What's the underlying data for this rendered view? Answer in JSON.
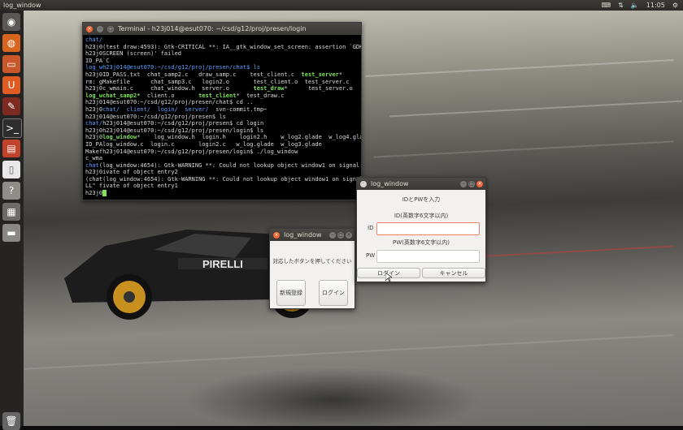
{
  "topbar": {
    "title": "log_window",
    "time": "11:05",
    "icons": [
      "keyboard-icon",
      "network-icon",
      "volume-icon",
      "gear-icon"
    ]
  },
  "launcher": {
    "items": [
      "ubuntu-dash-icon",
      "firefox-icon",
      "files-icon",
      "software-center-icon",
      "system-settings-icon",
      "terminal-icon",
      "app-icon",
      "document-icon",
      "help-icon",
      "workspace-switcher-icon",
      "drive-icon",
      "trash-icon"
    ]
  },
  "terminal": {
    "title": "Terminal - h23j014@esut070: ~/csd/g12/proj/presen/login",
    "lines": [
      [
        {
          "t": "chat/",
          "c": "b"
        }
      ],
      [
        {
          "t": "h23j0(test draw:4593): Gtk-CRITICAL **: IA__gtk_window_set_screen: assertion `GDK_IS"
        }
      ],
      [
        {
          "t": "h23j0SCREEN (screen)' failed"
        }
      ],
      [
        {
          "t": "ID_PA`C"
        }
      ],
      [
        {
          "t": "log_wh23j014@esut070:~/csd/g12/proj/presen/chat$ ls",
          "c": "b"
        }
      ],
      [
        {
          "t": "h23j0ID_PASS.txt  chat_samp2.c   draw_samp.c    test_client.c  "
        },
        {
          "t": "test_server",
          "c": "g"
        },
        {
          "t": "*"
        }
      ],
      [
        {
          "t": "rm: gMakefile      chat_samp3.c   login2.o       test_client.o  test_server.c"
        }
      ],
      [
        {
          "t": "h23j0c_wmain.c     chat_window.h  server.o       "
        },
        {
          "t": "test_draw",
          "c": "g"
        },
        {
          "t": "*      test_server.o"
        }
      ],
      [
        {
          "t": "log_wchat_samp2*",
          "c": "g"
        },
        {
          "t": "  client.o       "
        },
        {
          "t": "test_client",
          "c": "g"
        },
        {
          "t": "*  test_draw.c"
        }
      ],
      [
        {
          "t": "h23j014@esut070:~/csd/g12/proj/presen/chat$ cd .."
        }
      ],
      [
        {
          "t": "h23j0"
        },
        {
          "t": "chat/  client/  login/  server/",
          "c": "b"
        },
        {
          "t": "  svn-commit.tmp~"
        }
      ],
      [
        {
          "t": "h23j014@esut070:~/csd/g12/proj/presen$ ls"
        }
      ],
      [
        {
          "t": "chat/",
          "c": "b"
        },
        {
          "t": "h23j014@esut070:~/csd/g12/proj/presen$ cd login"
        }
      ],
      [
        {
          "t": "h23j0h23j014@esut070:~/csd/g12/proj/presen/login$ ls"
        }
      ],
      [
        {
          "t": "h23j0"
        },
        {
          "t": "log_window",
          "c": "g"
        },
        {
          "t": "*    log_window.h  login.h    login2.h    w_log2.glade  w_log4.glade"
        }
      ],
      [
        {
          "t": "ID_PAlog_window.c  login.c       login2.c   w_log.glade  w_log3.glade"
        }
      ],
      [
        {
          "t": "Makefh23j014@esut070:~/csd/g12/proj/presen/login$ ./log_window"
        }
      ],
      [
        {
          "t": "c_wma"
        }
      ],
      [
        {
          "t": "chat",
          "c": "b"
        },
        {
          "t": "(log_window:4654): Gtk-WARNING **: Could not lookup object window1 on signal act"
        }
      ],
      [
        {
          "t": "h23j0ivate of object entry2"
        }
      ],
      [
        {
          "t": ""
        }
      ],
      [
        {
          "t": "(chat(log_window:4654): Gtk-WARNING **: Could not lookup object window1 on signal act"
        }
      ],
      [
        {
          "t": "LL\" fivate of object entry1"
        }
      ],
      [
        {
          "t": "h23j0"
        }
      ]
    ]
  },
  "small_window": {
    "title": "log_window",
    "message": "対応したボタンを押してください",
    "register_label": "新規登録",
    "login_label": "ログイン"
  },
  "login_window": {
    "title": "log_window",
    "heading": "IDとPWを入力",
    "id_hint": "ID(英数字6文字以内)",
    "id_label": "ID",
    "id_value": "",
    "pw_hint": "PW(英数字6文字以内)",
    "pw_label": "PW",
    "pw_value": "",
    "login_label": "ログイン",
    "cancel_label": "キャンセル"
  },
  "colors": {
    "accent_orange": "#f06838",
    "terminal_green": "#7fe35c",
    "terminal_blue": "#5ba0ff"
  }
}
